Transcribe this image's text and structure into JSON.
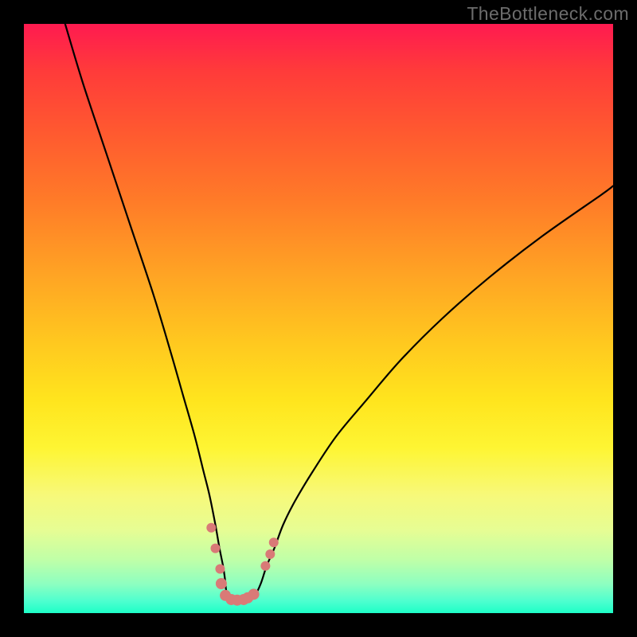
{
  "watermark": {
    "text": "TheBottleneck.com"
  },
  "chart_data": {
    "type": "line",
    "title": "",
    "xlabel": "",
    "ylabel": "",
    "xlim": [
      0,
      100
    ],
    "ylim": [
      0,
      100
    ],
    "grid": false,
    "series": [
      {
        "name": "bottleneck-curve",
        "is_filled": false,
        "stroke": "#000000",
        "x": [
          7,
          10,
          14,
          18,
          22,
          25,
          27,
          29,
          30.5,
          31.5,
          32.5,
          33.2,
          33.8,
          34.1,
          34.5,
          35.5,
          36.8,
          38.0,
          39.2,
          40.2,
          41.2,
          42.5,
          44,
          46,
          49,
          53,
          58,
          64,
          71,
          79,
          88,
          98,
          100
        ],
        "y": [
          100,
          90,
          78,
          66,
          54,
          44,
          37,
          30,
          24,
          20,
          15,
          11,
          8,
          6,
          3,
          2.2,
          2.0,
          2.2,
          3.0,
          5.0,
          8,
          11,
          15,
          19,
          24,
          30,
          36,
          43,
          50,
          57,
          64,
          71,
          72.5
        ]
      },
      {
        "name": "fit-markers",
        "is_markers": true,
        "stroke": "#d97a77",
        "points": [
          {
            "x": 31.8,
            "y": 14.5,
            "r": 6
          },
          {
            "x": 32.5,
            "y": 11.0,
            "r": 6
          },
          {
            "x": 33.3,
            "y": 7.5,
            "r": 6
          },
          {
            "x": 33.5,
            "y": 5.0,
            "r": 7
          },
          {
            "x": 34.2,
            "y": 3.0,
            "r": 7
          },
          {
            "x": 35.2,
            "y": 2.3,
            "r": 7
          },
          {
            "x": 36.2,
            "y": 2.2,
            "r": 7
          },
          {
            "x": 37.3,
            "y": 2.3,
            "r": 7
          },
          {
            "x": 38.0,
            "y": 2.6,
            "r": 7
          },
          {
            "x": 39.0,
            "y": 3.2,
            "r": 7
          },
          {
            "x": 41.0,
            "y": 8.0,
            "r": 6
          },
          {
            "x": 41.8,
            "y": 10.0,
            "r": 6
          },
          {
            "x": 42.4,
            "y": 12.0,
            "r": 6
          }
        ]
      }
    ],
    "gradient_stops": [
      {
        "pos": 0,
        "color": "#ff1a50"
      },
      {
        "pos": 8,
        "color": "#ff3b3a"
      },
      {
        "pos": 18,
        "color": "#ff5830"
      },
      {
        "pos": 30,
        "color": "#ff7b28"
      },
      {
        "pos": 42,
        "color": "#ffa224"
      },
      {
        "pos": 54,
        "color": "#ffc81f"
      },
      {
        "pos": 64,
        "color": "#ffe51e"
      },
      {
        "pos": 72,
        "color": "#fef533"
      },
      {
        "pos": 80,
        "color": "#f7f97a"
      },
      {
        "pos": 86,
        "color": "#e6fd94"
      },
      {
        "pos": 91,
        "color": "#bfffa8"
      },
      {
        "pos": 95,
        "color": "#8effc0"
      },
      {
        "pos": 98,
        "color": "#4dffcf"
      },
      {
        "pos": 100,
        "color": "#1dffc7"
      }
    ]
  }
}
